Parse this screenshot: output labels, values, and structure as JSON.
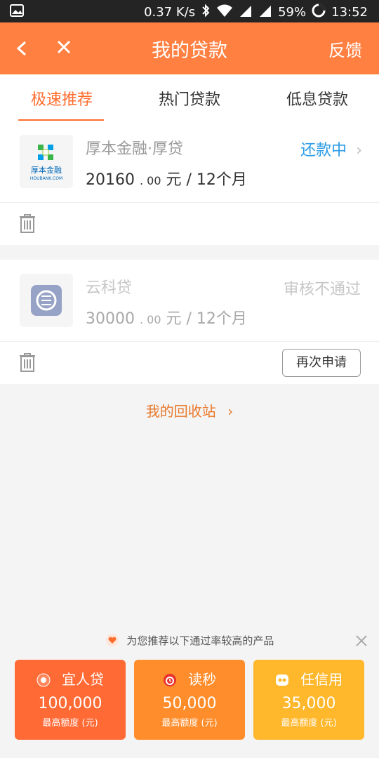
{
  "status_bar": {
    "speed": "0.37 K/s",
    "battery": "59%",
    "time": "13:52"
  },
  "app_bar": {
    "title": "我的贷款",
    "feedback": "反馈"
  },
  "tabs": [
    "极速推荐",
    "热门贷款",
    "低息贷款"
  ],
  "loans": [
    {
      "name": "厚本金融·厚贷",
      "amount_main": "20160",
      "amount_cents": ". 00",
      "amount_suffix": "元 / 12个月",
      "status": "还款中",
      "logo_text": "厚本金融",
      "logo_sub": "HOUBANK.COM"
    },
    {
      "name": "云科贷",
      "amount_main": "30000",
      "amount_cents": ". 00",
      "amount_suffix": "元 / 12个月",
      "status": "审核不通过",
      "reapply": "再次申请"
    }
  ],
  "recycle": "我的回收站",
  "recommend": {
    "note": "为您推荐以下通过率较高的产品",
    "products": [
      {
        "name": "宜人贷",
        "value": "100,000",
        "label": "最高额度 (元)"
      },
      {
        "name": "读秒",
        "value": "50,000",
        "label": "最高额度 (元)"
      },
      {
        "name": "任信用",
        "value": "35,000",
        "label": "最高额度 (元)"
      }
    ]
  },
  "colors": {
    "accent": "#ff8041",
    "blue_status": "#2a9be6"
  }
}
